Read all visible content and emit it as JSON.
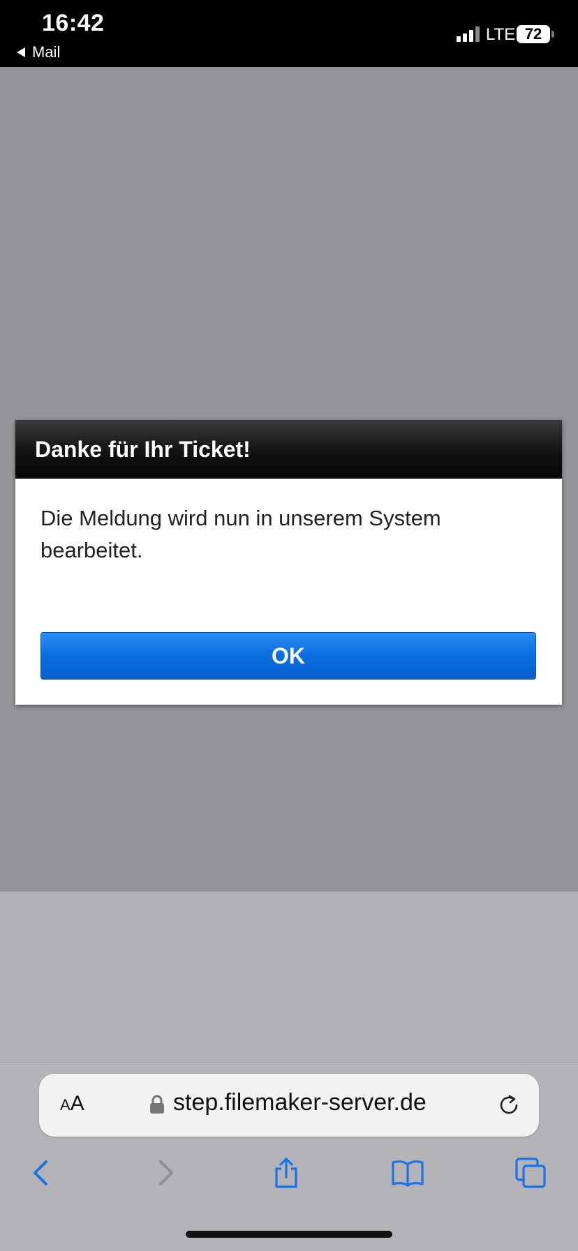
{
  "status_bar": {
    "time": "16:42",
    "back_app": "Mail",
    "network": "LTE",
    "battery": "72"
  },
  "dialog": {
    "title": "Danke für Ihr Ticket!",
    "message": "Die Meldung wird nun in unserem System bearbeitet.",
    "ok_label": "OK"
  },
  "browser": {
    "aa_small": "A",
    "aa_large": "A",
    "url": "step.filemaker-server.de"
  },
  "colors": {
    "accent": "#0a6ee0",
    "ios_blue": "#1a73e8",
    "page_overlay": "#959499"
  },
  "icons": {
    "back": "chevron-left-icon",
    "forward": "chevron-right-icon",
    "share": "share-icon",
    "bookmarks": "book-icon",
    "tabs": "tabs-icon",
    "reload": "reload-icon",
    "lock": "lock-icon"
  }
}
